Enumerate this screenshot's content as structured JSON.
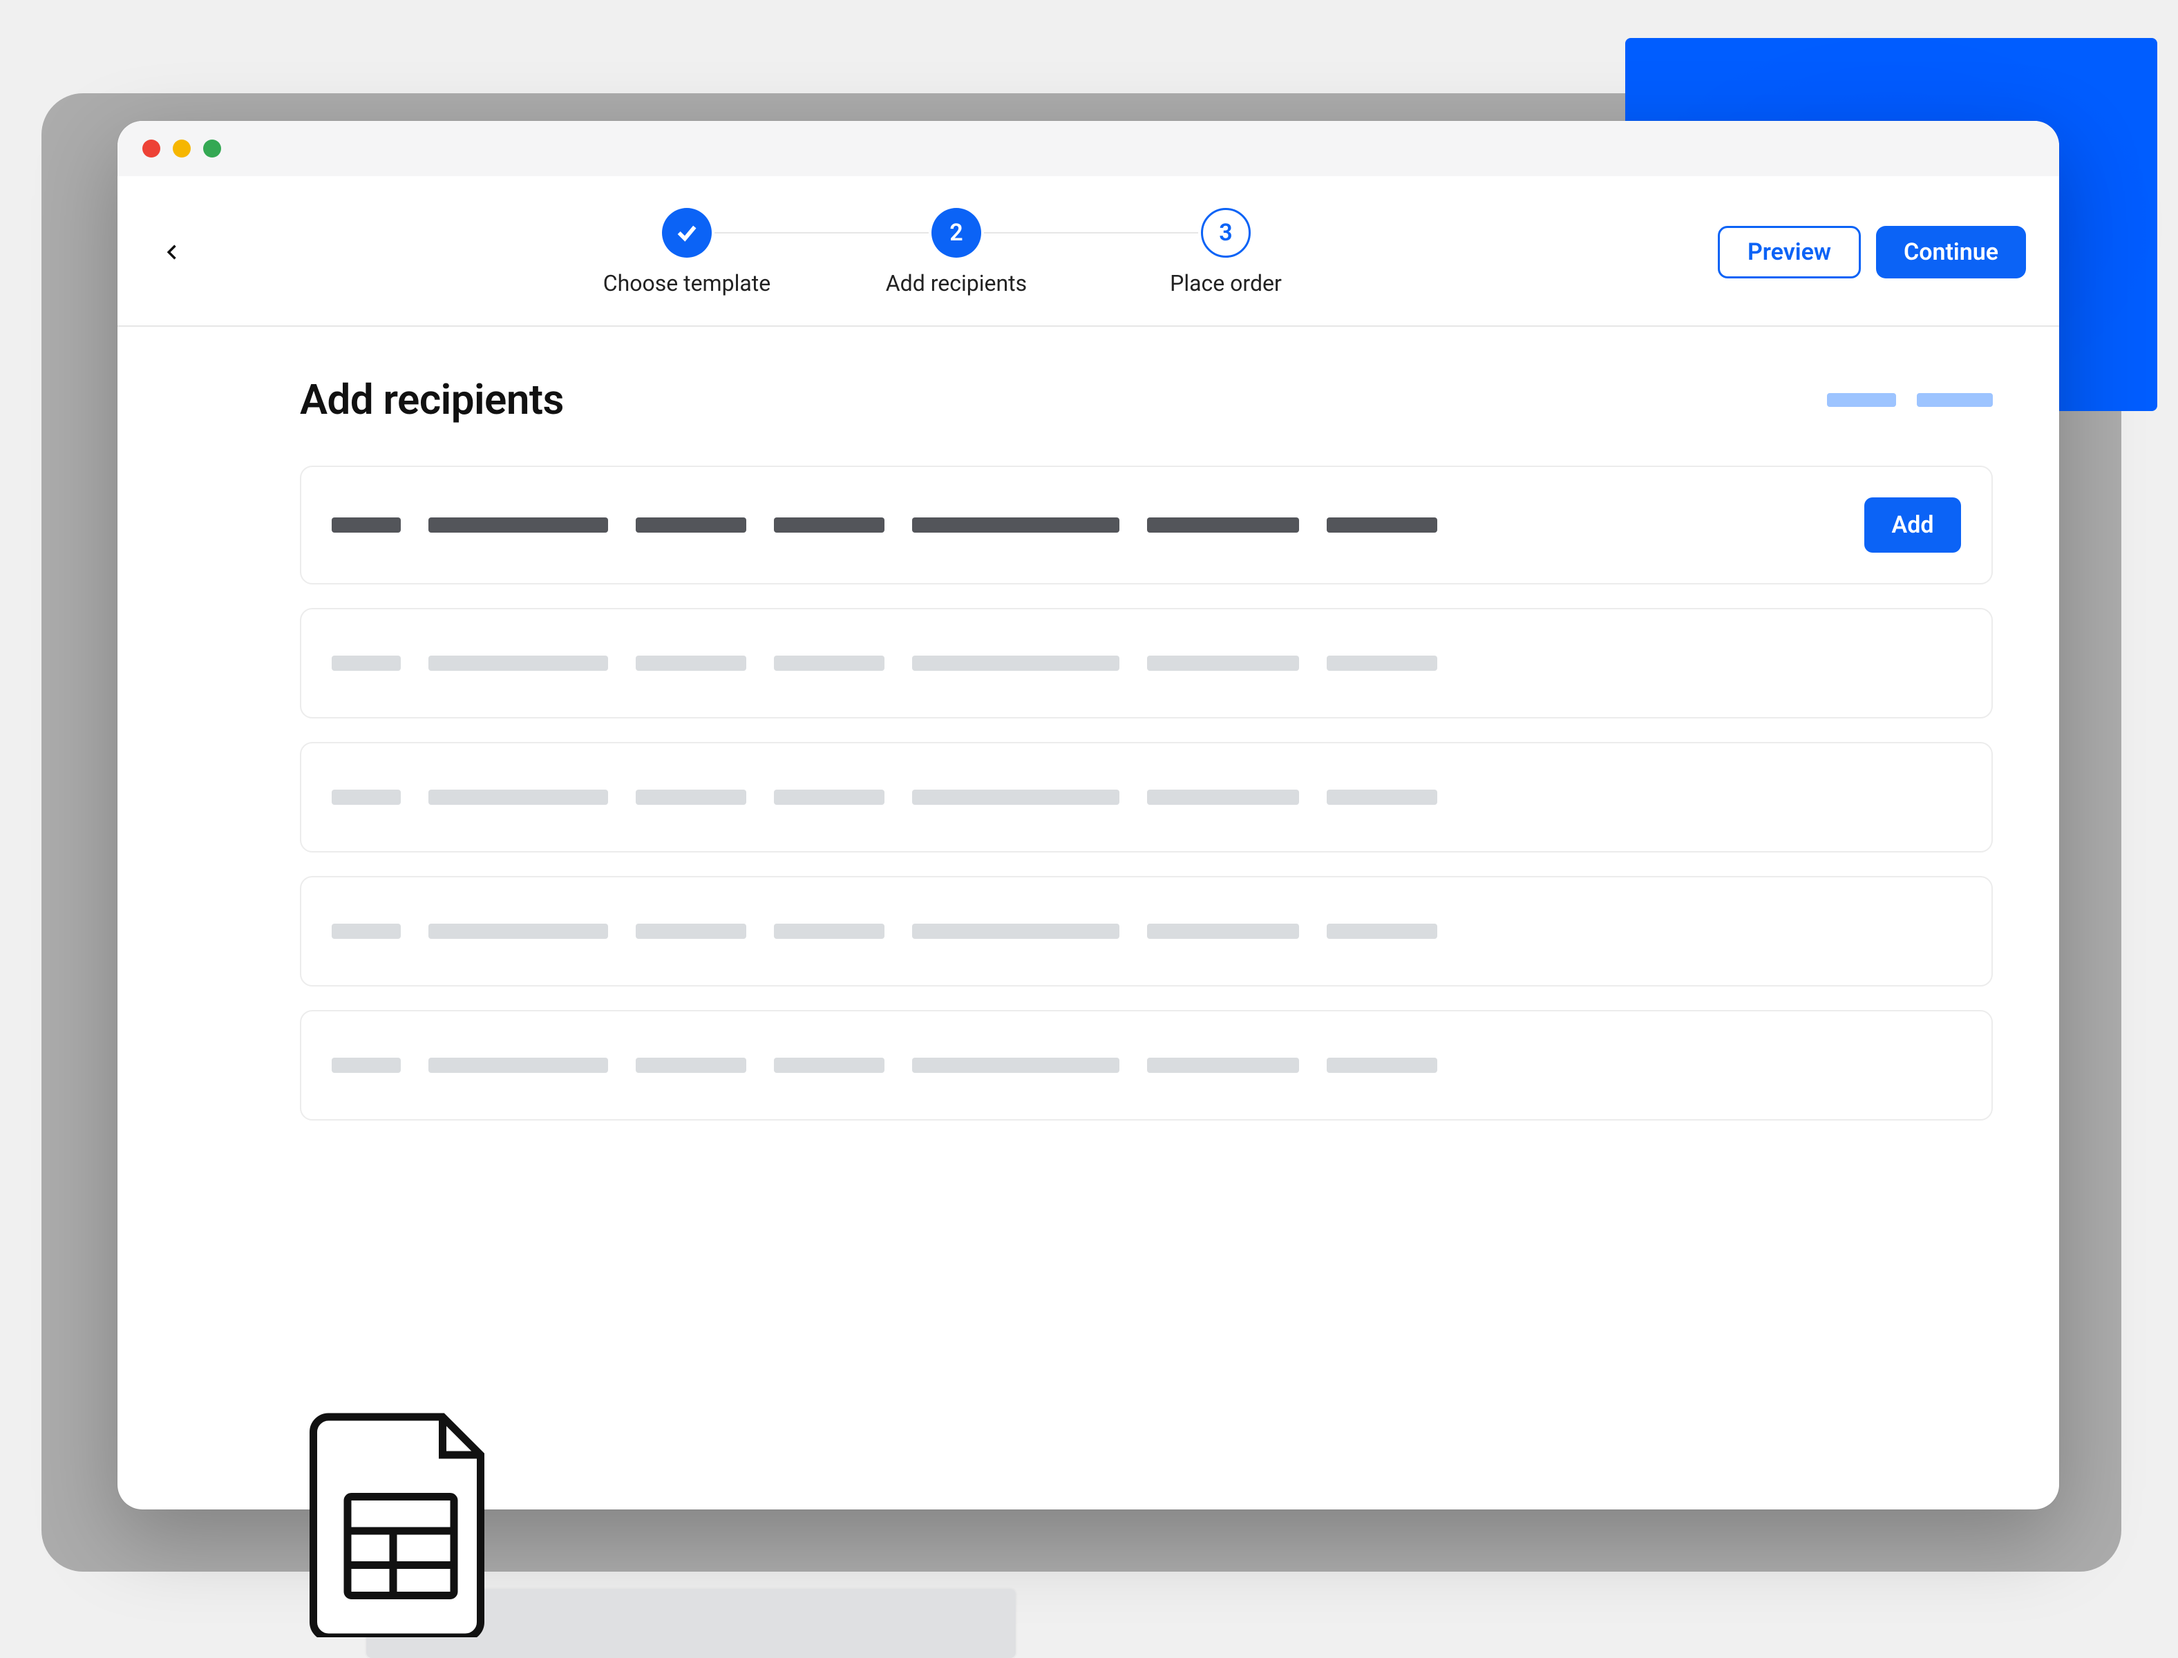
{
  "colors": {
    "accent": "#0b63f6",
    "accentLight": "#9dc4ff"
  },
  "header": {
    "preview": "Preview",
    "continue": "Continue"
  },
  "stepper": {
    "steps": [
      {
        "label": "Choose template",
        "done": true,
        "num": "1"
      },
      {
        "label": "Add recipients",
        "done": false,
        "num": "2",
        "active": true
      },
      {
        "label": "Place order",
        "done": false,
        "num": "3"
      }
    ]
  },
  "page": {
    "title": "Add recipients",
    "addLabel": "Add"
  }
}
